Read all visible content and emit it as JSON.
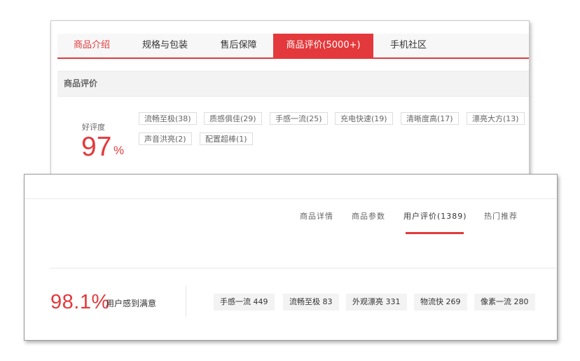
{
  "window_back": {
    "tabs": [
      {
        "label": "商品介绍"
      },
      {
        "label": "规格与包装"
      },
      {
        "label": "售后保障"
      },
      {
        "label": "商品评价(5000+)"
      },
      {
        "label": "手机社区"
      }
    ],
    "section_title": "商品评价",
    "good_rate_label": "好评度",
    "good_rate_value": "97",
    "good_rate_unit": "%",
    "tags": [
      "流畅至极(38)",
      "质感俱佳(29)",
      "手感一流(25)",
      "充电快速(19)",
      "清晰度高(17)",
      "漂亮大方(13)",
      "声音洪亮(2)",
      "配置超棒(1)"
    ]
  },
  "window_front": {
    "tabs": [
      {
        "label": "商品详情"
      },
      {
        "label": "商品参数"
      },
      {
        "label": "用户评价(1389)"
      },
      {
        "label": "热门推荐"
      }
    ],
    "satisfaction_value": "98.1%",
    "satisfaction_label": "用户感到满意",
    "tags": [
      "手感一流 449",
      "流畅至极 83",
      "外观漂亮 331",
      "物流快 269",
      "像素一流 280"
    ]
  },
  "colors": {
    "accent": "#e4393c",
    "tag_bg": "#f3f3f3",
    "tab_bar_bg": "#f7f7f7"
  }
}
